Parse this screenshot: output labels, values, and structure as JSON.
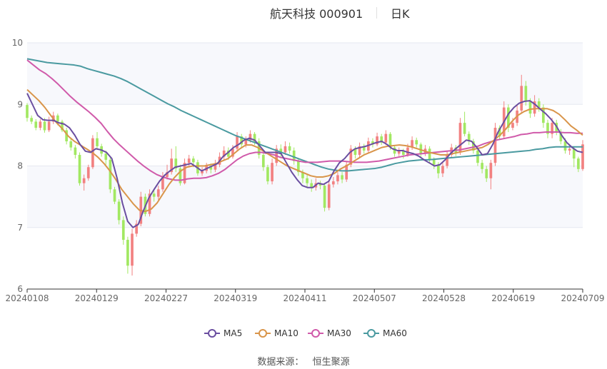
{
  "header": {
    "title": "航天科技 000901",
    "period": "日K"
  },
  "footer": {
    "source_label": "数据来源：",
    "source_name": "恒生聚源"
  },
  "chart_data": {
    "type": "candlestick",
    "title": "航天科技 000901",
    "subtitle": "日K",
    "ylim": [
      6,
      10
    ],
    "yticks": [
      6,
      7,
      8,
      9,
      10
    ],
    "xticks": [
      "20240108",
      "20240129",
      "20240227",
      "20240319",
      "20240411",
      "20240507",
      "20240528",
      "20240619",
      "20240709"
    ],
    "legend_position": "bottom",
    "colors": {
      "up": "#f28181",
      "down": "#a2e862",
      "ma5": "#6a4ea0",
      "ma10": "#d9954a",
      "ma30": "#d05aaa",
      "ma60": "#4a9aa0",
      "grid": "#e6e8f0",
      "band": "#f7f8fc"
    },
    "legend": [
      {
        "key": "ma5",
        "label": "MA5"
      },
      {
        "key": "ma10",
        "label": "MA10"
      },
      {
        "key": "ma30",
        "label": "MA30"
      },
      {
        "key": "ma60",
        "label": "MA60"
      }
    ],
    "candles": [
      [
        8.99,
        8.78,
        9.02,
        8.72
      ],
      [
        8.78,
        8.72,
        8.82,
        8.68
      ],
      [
        8.72,
        8.62,
        8.76,
        8.58
      ],
      [
        8.62,
        8.72,
        8.76,
        8.58
      ],
      [
        8.72,
        8.58,
        8.78,
        8.54
      ],
      [
        8.58,
        8.72,
        8.8,
        8.55
      ],
      [
        8.72,
        8.82,
        8.88,
        8.68
      ],
      [
        8.82,
        8.72,
        8.85,
        8.66
      ],
      [
        8.72,
        8.58,
        8.75,
        8.55
      ],
      [
        8.58,
        8.4,
        8.62,
        8.35
      ],
      [
        8.4,
        8.3,
        8.44,
        8.25
      ],
      [
        8.3,
        8.18,
        8.34,
        8.12
      ],
      [
        8.18,
        7.72,
        8.22,
        7.68
      ],
      [
        7.72,
        7.8,
        7.86,
        7.6
      ],
      [
        7.8,
        7.98,
        8.02,
        7.76
      ],
      [
        7.98,
        8.45,
        8.5,
        7.95
      ],
      [
        8.45,
        8.32,
        8.55,
        8.28
      ],
      [
        8.32,
        8.2,
        8.36,
        8.15
      ],
      [
        8.2,
        8.1,
        8.25,
        8.02
      ],
      [
        8.1,
        7.62,
        8.14,
        7.56
      ],
      [
        7.62,
        7.42,
        7.66,
        7.38
      ],
      [
        7.42,
        7.12,
        7.46,
        7.05
      ],
      [
        7.12,
        6.8,
        7.18,
        6.72
      ],
      [
        6.8,
        6.38,
        6.85,
        6.25
      ],
      [
        6.38,
        6.9,
        6.98,
        6.22
      ],
      [
        6.9,
        7.06,
        7.12,
        6.85
      ],
      [
        7.06,
        7.5,
        7.58,
        7.02
      ],
      [
        7.5,
        7.22,
        7.55,
        7.18
      ],
      [
        7.22,
        7.55,
        7.62,
        7.18
      ],
      [
        7.55,
        7.5,
        7.62,
        7.42
      ],
      [
        7.5,
        7.62,
        7.68,
        7.45
      ],
      [
        7.62,
        7.82,
        7.9,
        7.58
      ],
      [
        7.82,
        7.9,
        8.02,
        7.78
      ],
      [
        7.9,
        8.12,
        8.28,
        7.86
      ],
      [
        8.12,
        7.96,
        8.32,
        7.9
      ],
      [
        7.96,
        7.72,
        8.02,
        7.68
      ],
      [
        7.72,
        8.05,
        8.12,
        7.7
      ],
      [
        8.05,
        8.12,
        8.18,
        8.0
      ],
      [
        8.12,
        8.06,
        8.16,
        7.98
      ],
      [
        8.06,
        7.88,
        8.1,
        7.84
      ],
      [
        7.88,
        7.92,
        7.98,
        7.84
      ],
      [
        7.92,
        8.0,
        8.05,
        7.88
      ],
      [
        8.0,
        7.94,
        8.04,
        7.88
      ],
      [
        7.94,
        8.02,
        8.1,
        7.9
      ],
      [
        8.02,
        8.15,
        8.22,
        7.98
      ],
      [
        8.15,
        8.25,
        8.32,
        8.1
      ],
      [
        8.25,
        8.15,
        8.3,
        8.1
      ],
      [
        8.15,
        8.28,
        8.34,
        8.12
      ],
      [
        8.28,
        8.48,
        8.55,
        8.24
      ],
      [
        8.48,
        8.35,
        8.52,
        8.3
      ],
      [
        8.35,
        8.42,
        8.48,
        8.3
      ],
      [
        8.42,
        8.52,
        8.58,
        8.38
      ],
      [
        8.52,
        8.4,
        8.55,
        8.34
      ],
      [
        8.4,
        8.18,
        8.45,
        8.12
      ],
      [
        8.18,
        7.98,
        8.24,
        7.92
      ],
      [
        7.98,
        7.75,
        8.02,
        7.7
      ],
      [
        7.75,
        8.05,
        8.12,
        7.7
      ],
      [
        8.05,
        8.28,
        8.34,
        8.0
      ],
      [
        8.28,
        8.22,
        8.35,
        8.15
      ],
      [
        8.22,
        8.32,
        8.4,
        8.18
      ],
      [
        8.32,
        8.25,
        8.38,
        8.2
      ],
      [
        8.25,
        8.08,
        8.3,
        8.02
      ],
      [
        8.08,
        7.9,
        8.12,
        7.84
      ],
      [
        7.9,
        7.8,
        7.94,
        7.72
      ],
      [
        7.8,
        7.72,
        7.86,
        7.64
      ],
      [
        7.72,
        7.65,
        7.78,
        7.58
      ],
      [
        7.65,
        7.72,
        7.8,
        7.6
      ],
      [
        7.72,
        7.68,
        7.76,
        7.62
      ],
      [
        7.68,
        7.32,
        7.72,
        7.26
      ],
      [
        7.32,
        7.7,
        7.76,
        7.28
      ],
      [
        7.7,
        7.75,
        7.82,
        7.65
      ],
      [
        7.75,
        7.85,
        7.9,
        7.7
      ],
      [
        7.85,
        7.78,
        7.9,
        7.72
      ],
      [
        7.78,
        8.02,
        8.08,
        7.74
      ],
      [
        8.02,
        8.28,
        8.34,
        7.98
      ],
      [
        8.28,
        8.18,
        8.32,
        8.12
      ],
      [
        8.18,
        8.32,
        8.38,
        8.14
      ],
      [
        8.32,
        8.25,
        8.36,
        8.2
      ],
      [
        8.25,
        8.4,
        8.46,
        8.22
      ],
      [
        8.4,
        8.35,
        8.45,
        8.3
      ],
      [
        8.35,
        8.48,
        8.54,
        8.32
      ],
      [
        8.48,
        8.38,
        8.52,
        8.34
      ],
      [
        8.38,
        8.52,
        8.58,
        8.34
      ],
      [
        8.52,
        8.3,
        8.55,
        8.26
      ],
      [
        8.3,
        8.2,
        8.34,
        8.15
      ],
      [
        8.2,
        8.25,
        8.3,
        8.16
      ],
      [
        8.25,
        8.18,
        8.28,
        8.12
      ],
      [
        8.18,
        8.3,
        8.36,
        8.15
      ],
      [
        8.3,
        8.42,
        8.48,
        8.26
      ],
      [
        8.42,
        8.35,
        8.46,
        8.3
      ],
      [
        8.35,
        8.2,
        8.38,
        8.14
      ],
      [
        8.2,
        8.28,
        8.34,
        8.16
      ],
      [
        8.28,
        8.1,
        8.32,
        8.05
      ],
      [
        8.1,
        8.02,
        8.14,
        7.95
      ],
      [
        8.02,
        7.88,
        8.06,
        7.8
      ],
      [
        7.88,
        8.0,
        8.05,
        7.82
      ],
      [
        8.0,
        8.18,
        8.24,
        7.96
      ],
      [
        8.18,
        8.3,
        8.36,
        8.14
      ],
      [
        8.3,
        8.22,
        8.34,
        8.16
      ],
      [
        8.22,
        8.7,
        8.78,
        8.18
      ],
      [
        8.7,
        8.52,
        8.88,
        8.48
      ],
      [
        8.52,
        8.4,
        8.56,
        8.34
      ],
      [
        8.4,
        8.25,
        8.44,
        8.2
      ],
      [
        8.25,
        8.05,
        8.3,
        8.0
      ],
      [
        8.05,
        7.95,
        8.1,
        7.88
      ],
      [
        7.95,
        7.8,
        8.0,
        7.74
      ],
      [
        7.8,
        8.05,
        8.1,
        7.62
      ],
      [
        8.05,
        8.62,
        8.7,
        8.0
      ],
      [
        8.62,
        8.48,
        8.66,
        8.42
      ],
      [
        8.48,
        8.95,
        9.05,
        8.44
      ],
      [
        8.95,
        8.62,
        9.0,
        8.55
      ],
      [
        8.62,
        8.7,
        8.78,
        8.58
      ],
      [
        8.7,
        8.9,
        9.0,
        8.65
      ],
      [
        8.9,
        9.3,
        9.48,
        8.86
      ],
      [
        9.3,
        9.05,
        9.38,
        8.98
      ],
      [
        9.05,
        8.85,
        9.1,
        8.78
      ],
      [
        8.85,
        9.05,
        9.15,
        8.8
      ],
      [
        9.05,
        8.95,
        9.1,
        8.88
      ],
      [
        8.95,
        8.7,
        9.0,
        8.62
      ],
      [
        8.7,
        8.52,
        8.75,
        8.45
      ],
      [
        8.52,
        8.7,
        8.78,
        8.45
      ],
      [
        8.7,
        8.55,
        8.75,
        8.5
      ],
      [
        8.55,
        8.4,
        8.6,
        8.35
      ],
      [
        8.4,
        8.25,
        8.45,
        8.2
      ],
      [
        8.25,
        8.28,
        8.35,
        8.18
      ],
      [
        8.28,
        8.12,
        8.32,
        7.98
      ],
      [
        8.12,
        7.95,
        8.15,
        7.9
      ],
      [
        7.95,
        8.35,
        8.42,
        7.92
      ]
    ],
    "ma": {
      "ma5": [
        9.18,
        9.0,
        8.82,
        8.75,
        8.74,
        8.74,
        8.7,
        8.68,
        8.62,
        8.5,
        8.35,
        8.24,
        8.22,
        8.28,
        8.26,
        8.22,
        8.12,
        7.8,
        7.4,
        7.1,
        7.0,
        7.05,
        7.28,
        7.48,
        7.62,
        7.75,
        7.85,
        7.92,
        7.98,
        8.0,
        8.02,
        8.04,
        7.98,
        7.92,
        7.96,
        8.0,
        8.04,
        8.15,
        8.22,
        8.3,
        8.35,
        8.42,
        8.45,
        8.42,
        8.32,
        8.22,
        8.22,
        8.22,
        8.2,
        8.05,
        7.9,
        7.78,
        7.68,
        7.65,
        7.65,
        7.72,
        7.7,
        7.75,
        7.92,
        8.05,
        8.12,
        8.22,
        8.28,
        8.3,
        8.32,
        8.35,
        8.38,
        8.4,
        8.35,
        8.28,
        8.25,
        8.25,
        8.22,
        8.2,
        8.16,
        8.1,
        8.05,
        8.0,
        8.02,
        8.1,
        8.2,
        8.28,
        8.35,
        8.42,
        8.4,
        8.3,
        8.18,
        8.2,
        8.35,
        8.55,
        8.7,
        8.85,
        8.95,
        9.02,
        9.05,
        9.06,
        9.0,
        8.92,
        8.85,
        8.76,
        8.65,
        8.5,
        8.38,
        8.3,
        8.24,
        8.22
      ],
      "ma10": [
        9.24,
        9.15,
        9.06,
        8.95,
        8.82,
        8.7,
        8.6,
        8.48,
        8.4,
        8.34,
        8.28,
        8.22,
        8.14,
        8.04,
        7.92,
        7.78,
        7.62,
        7.5,
        7.38,
        7.28,
        7.26,
        7.3,
        7.4,
        7.55,
        7.7,
        7.82,
        7.92,
        7.98,
        8.0,
        8.0,
        8.0,
        8.02,
        8.04,
        8.08,
        8.12,
        8.2,
        8.28,
        8.34,
        8.34,
        8.3,
        8.24,
        8.18,
        8.12,
        8.06,
        8.0,
        7.96,
        7.92,
        7.88,
        7.84,
        7.82,
        7.82,
        7.84,
        7.88,
        7.95,
        8.0,
        8.06,
        8.12,
        8.18,
        8.22,
        8.26,
        8.3,
        8.32,
        8.33,
        8.34,
        8.33,
        8.31,
        8.28,
        8.25,
        8.22,
        8.2,
        8.18,
        8.18,
        8.2,
        8.22,
        8.24,
        8.26,
        8.28,
        8.3,
        8.35,
        8.42,
        8.5,
        8.6,
        8.72,
        8.82,
        8.88,
        8.92,
        8.93,
        8.93,
        8.93,
        8.9,
        8.84,
        8.75,
        8.65,
        8.58,
        8.5
      ],
      "ma30": [
        9.72,
        9.64,
        9.56,
        9.5,
        9.42,
        9.33,
        9.23,
        9.13,
        9.04,
        8.96,
        8.88,
        8.79,
        8.69,
        8.56,
        8.44,
        8.34,
        8.25,
        8.16,
        8.07,
        7.99,
        7.92,
        7.86,
        7.82,
        7.79,
        7.77,
        7.77,
        7.79,
        7.8,
        7.8,
        7.81,
        7.84,
        7.88,
        7.94,
        8.02,
        8.1,
        8.16,
        8.2,
        8.22,
        8.22,
        8.2,
        8.18,
        8.14,
        8.12,
        8.1,
        8.08,
        8.06,
        8.06,
        8.06,
        8.07,
        8.08,
        8.08,
        8.08,
        8.07,
        8.06,
        8.06,
        8.06,
        8.07,
        8.08,
        8.1,
        8.12,
        8.14,
        8.16,
        8.18,
        8.19,
        8.2,
        8.21,
        8.22,
        8.23,
        8.24,
        8.25,
        8.26,
        8.28,
        8.3,
        8.32,
        8.36,
        8.39,
        8.42,
        8.44,
        8.46,
        8.48,
        8.51,
        8.52,
        8.54,
        8.54,
        8.55,
        8.55,
        8.55,
        8.54,
        8.54,
        8.53,
        8.53
      ],
      "ma60": [
        9.74,
        9.72,
        9.7,
        9.68,
        9.67,
        9.66,
        9.65,
        9.64,
        9.62,
        9.58,
        9.55,
        9.52,
        9.49,
        9.46,
        9.42,
        9.37,
        9.31,
        9.25,
        9.19,
        9.13,
        9.07,
        9.01,
        8.96,
        8.9,
        8.85,
        8.8,
        8.75,
        8.7,
        8.65,
        8.6,
        8.55,
        8.5,
        8.46,
        8.42,
        8.38,
        8.34,
        8.3,
        8.26,
        8.22,
        8.18,
        8.14,
        8.1,
        8.06,
        8.02,
        7.98,
        7.95,
        7.93,
        7.92,
        7.92,
        7.93,
        7.94,
        7.95,
        7.96,
        7.98,
        8.01,
        8.04,
        8.06,
        8.08,
        8.09,
        8.1,
        8.1,
        8.11,
        8.12,
        8.13,
        8.14,
        8.15,
        8.16,
        8.17,
        8.18,
        8.19,
        8.2,
        8.21,
        8.22,
        8.23,
        8.24,
        8.25,
        8.27,
        8.28,
        8.3,
        8.31,
        8.31,
        8.31,
        8.31,
        8.31
      ]
    }
  }
}
